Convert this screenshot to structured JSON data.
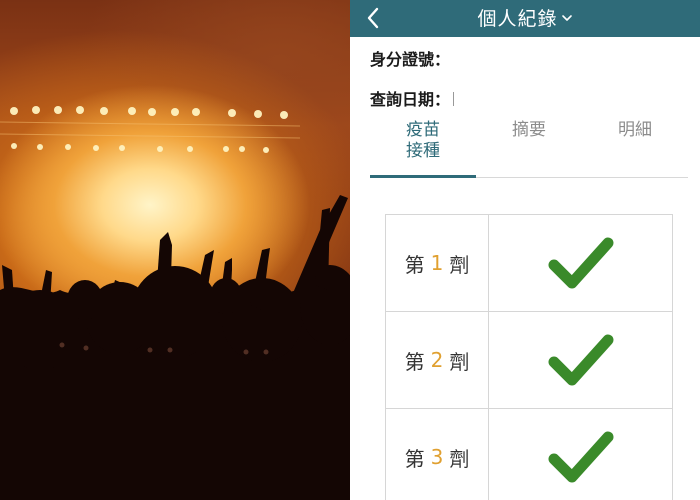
{
  "photo": {
    "subject": "concert-crowd-image"
  },
  "nav": {
    "back_icon": "chevron-left-icon",
    "title": "個人紀錄",
    "dropdown_icon": "chevron-down-icon"
  },
  "info": {
    "id_label": "身分證號：",
    "date_label": "查詢日期："
  },
  "tabs": [
    {
      "label_line1": "疫苗",
      "label_line2": "接種",
      "active": true
    },
    {
      "label_line1": "摘要",
      "label_line2": "",
      "active": false
    },
    {
      "label_line1": "明細",
      "label_line2": "",
      "active": false
    }
  ],
  "doses": [
    {
      "prefix": "第",
      "number": "1",
      "suffix": "劑",
      "status_icon": "check-icon"
    },
    {
      "prefix": "第",
      "number": "2",
      "suffix": "劑",
      "status_icon": "check-icon"
    },
    {
      "prefix": "第",
      "number": "3",
      "suffix": "劑",
      "status_icon": "check-icon"
    }
  ],
  "colors": {
    "nav_bg": "#2f6b79",
    "active_tab": "#2f6b79",
    "dose_number": "#e0a030",
    "check": "#3a8a2a"
  }
}
